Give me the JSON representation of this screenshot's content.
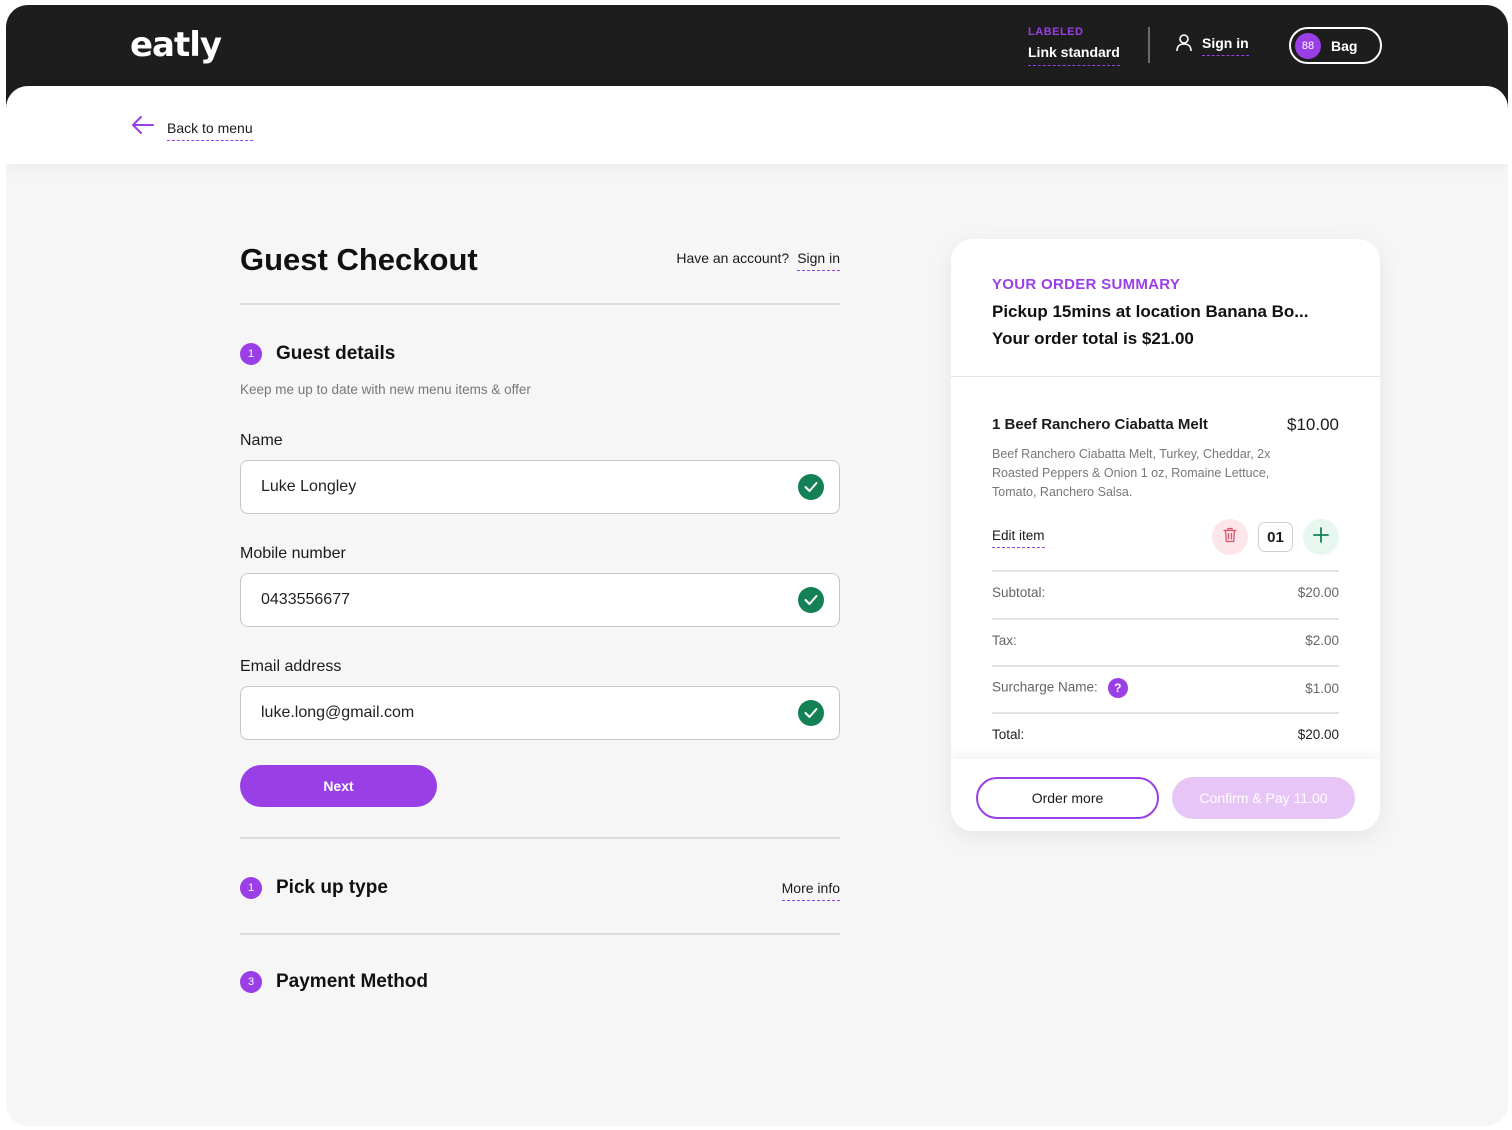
{
  "header": {
    "logo": "eatly",
    "link_label": "LABELED",
    "link_text": "Link standard",
    "signin": "Sign in",
    "bag_count": "88",
    "bag_label": "Bag"
  },
  "nav": {
    "back": "Back to menu"
  },
  "checkout": {
    "title": "Guest Checkout",
    "have_account": "Have an account?",
    "signin": "Sign in",
    "steps": [
      {
        "num": "1",
        "title": "Guest details"
      },
      {
        "num": "1",
        "title": "Pick up type",
        "action": "More info"
      },
      {
        "num": "3",
        "title": "Payment Method"
      }
    ],
    "subtext": "Keep me up to date with new menu items & offer",
    "fields": {
      "name": {
        "label": "Name",
        "value": "Luke Longley"
      },
      "mobile": {
        "label": "Mobile number",
        "value": "0433556677"
      },
      "email": {
        "label": "Email address",
        "value": "luke.long@gmail.com"
      }
    },
    "next": "Next"
  },
  "summary": {
    "label": "YOUR ORDER SUMMARY",
    "line1": "Pickup 15mins at location Banana Bo...",
    "line2": "Your order total is $21.00",
    "item": {
      "name": "1 Beef Ranchero Ciabatta Melt",
      "price": "$10.00",
      "desc": "Beef Ranchero Ciabatta Melt, Turkey, Cheddar, 2x Roasted Peppers & Onion 1 oz, Romaine Lettuce, Tomato, Ranchero Salsa.",
      "edit": "Edit item",
      "qty": "01"
    },
    "rows": [
      {
        "label": "Subtotal:",
        "value": "$20.00"
      },
      {
        "label": "Tax:",
        "value": "$2.00"
      },
      {
        "label": "Surcharge Name:",
        "value": "$1.00"
      },
      {
        "label": "Total:",
        "value": "$20.00"
      }
    ],
    "order_more": "Order more",
    "confirm_pay": "Confirm & Pay 11.00"
  },
  "colors": {
    "accent": "#9a3fe6",
    "success": "#148055",
    "header_bg": "#1d1d1d",
    "disabled_accent": "#e7c6f7"
  },
  "icons": [
    "arrow-left-icon",
    "user-icon",
    "check-icon",
    "trash-icon",
    "plus-icon",
    "question-icon"
  ]
}
